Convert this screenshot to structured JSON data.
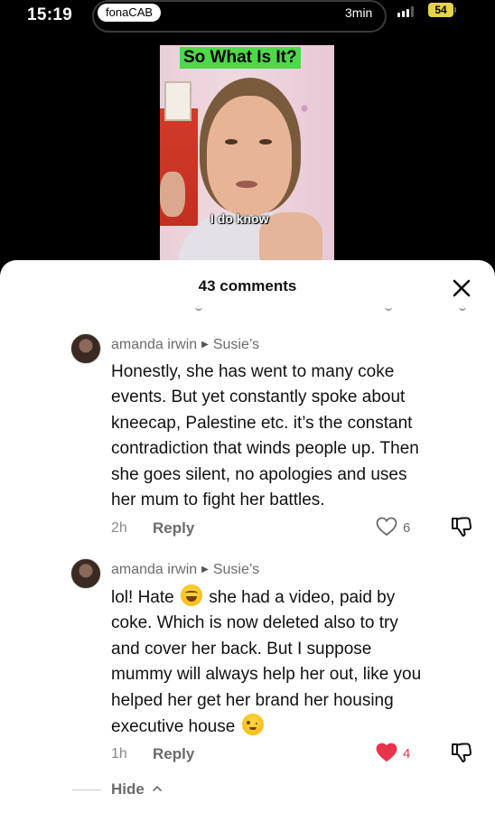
{
  "status_bar": {
    "time": "15:19",
    "app_name": "fonaCAB",
    "duration": "3min",
    "battery": "54"
  },
  "video": {
    "title_overlay": "So What Is It?",
    "caption": "I do know"
  },
  "comments_panel": {
    "title": "43 comments",
    "close_icon": "close-icon",
    "comments": [
      {
        "author": "amanda irwin",
        "reply_to": "Susie’s",
        "lines": [
          "Honestly, she has went to many coke",
          "events. But yet constantly spoke about",
          "kneecap, Palestine etc. it’s the constant",
          "contradiction that winds people up. Then",
          "she goes silent, no apologies and uses",
          "her mum to fight her battles."
        ],
        "time": "2h",
        "reply_label": "Reply",
        "likes": "6",
        "liked": false
      },
      {
        "author": "amanda irwin",
        "reply_to": "Susie’s",
        "line1_before": "lol! Hate",
        "line1_after": "she had a video, paid by",
        "lines": [
          "coke. Which is now deleted also to try",
          "and cover her back. But I suppose",
          "mummy will always help her out, like you",
          "helped her get her brand her housing"
        ],
        "last_line": "executive house",
        "time": "1h",
        "reply_label": "Reply",
        "likes": "4",
        "liked": true
      }
    ],
    "hide_label": "Hide"
  },
  "colors": {
    "like_active": "#e8334a",
    "title_overlay_bg": "#4fd84a",
    "battery": "#e6d34a"
  }
}
